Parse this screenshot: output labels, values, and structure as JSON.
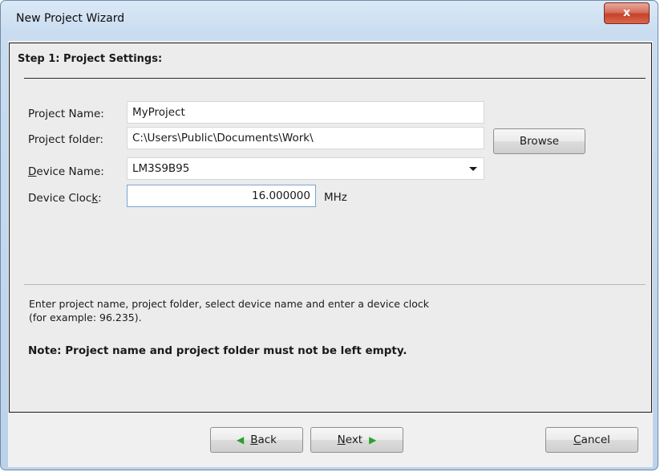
{
  "window": {
    "title": "New Project Wizard",
    "close_label": "x"
  },
  "step": {
    "title": "Step 1: Project Settings:"
  },
  "form": {
    "project_name": {
      "label": "Project Name:",
      "value": "MyProject"
    },
    "project_folder": {
      "label": "Project folder:",
      "value": "C:\\Users\\Public\\Documents\\Work\\"
    },
    "browse_label": "Browse",
    "device_name": {
      "label_prefix": "D",
      "label_rest": "evice Name:",
      "value": "LM3S9B95"
    },
    "device_clock": {
      "label_prefix": "Device Cloc",
      "label_accel": "k",
      "label_suffix": ":",
      "value": "16.000000",
      "units": "MHz"
    }
  },
  "help": {
    "text_line1": "Enter project name, project folder, select device name and enter a device clock",
    "text_line2": "(for example: 96.235).",
    "note": "Note: Project name and project folder must not be left empty."
  },
  "footer": {
    "back": {
      "accel": "B",
      "rest": "ack"
    },
    "next": {
      "accel": "N",
      "rest": "ext"
    },
    "cancel": {
      "accel": "C",
      "rest": "ancel"
    }
  },
  "icons": {
    "back_arrow": "left-arrow-icon",
    "next_arrow": "right-arrow-icon",
    "arrow_color": "#2aa12a"
  }
}
